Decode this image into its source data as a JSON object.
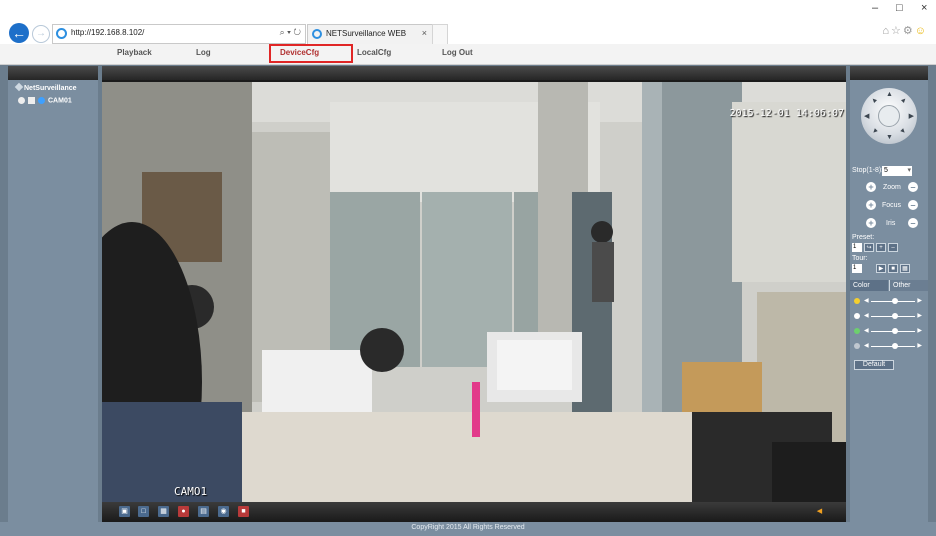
{
  "browser": {
    "url": "http://192.168.8.102/",
    "tab_title": "NETSurveillance WEB",
    "search_refresh": "⌕ ▾ ↻",
    "tab_close": "×",
    "win_min": "–",
    "win_max": "□",
    "win_close": "×"
  },
  "menu": {
    "items": [
      "Playback",
      "Log",
      "DeviceCfg",
      "LocalCfg",
      "Log Out"
    ],
    "active_index": 2
  },
  "left_panel": {
    "root_label": "NetSurveillance",
    "camera_label": "CAM01"
  },
  "video": {
    "timestamp": "2015-12-01 14:06:07",
    "camera_overlay": "CAMO1"
  },
  "ptz": {
    "step_label": "Stop(1-8):",
    "step_value": "5",
    "zoom_label": "Zoom",
    "focus_label": "Focus",
    "iris_label": "Iris",
    "preset_label": "Preset:",
    "preset_value": "1",
    "tour_label": "Tour:",
    "tour_value": "1"
  },
  "color": {
    "tabs": [
      "Color",
      "Other"
    ],
    "default_label": "Default",
    "sliders": [
      {
        "name": "brightness",
        "level": 0.55,
        "color": "#f4cf2e"
      },
      {
        "name": "contrast",
        "level": 0.55,
        "color": "#ffffff"
      },
      {
        "name": "saturation",
        "level": 0.55,
        "color": "#6dd06d"
      },
      {
        "name": "hue",
        "level": 0.55,
        "color": "#c0c8d0"
      }
    ]
  },
  "footer": {
    "copyright": "CopyRight 2015 All Rights Reserved"
  },
  "colors": {
    "panel_bg": "#7b8ea0",
    "accent_red": "#e02626",
    "ie_blue": "#1d6fc9"
  }
}
